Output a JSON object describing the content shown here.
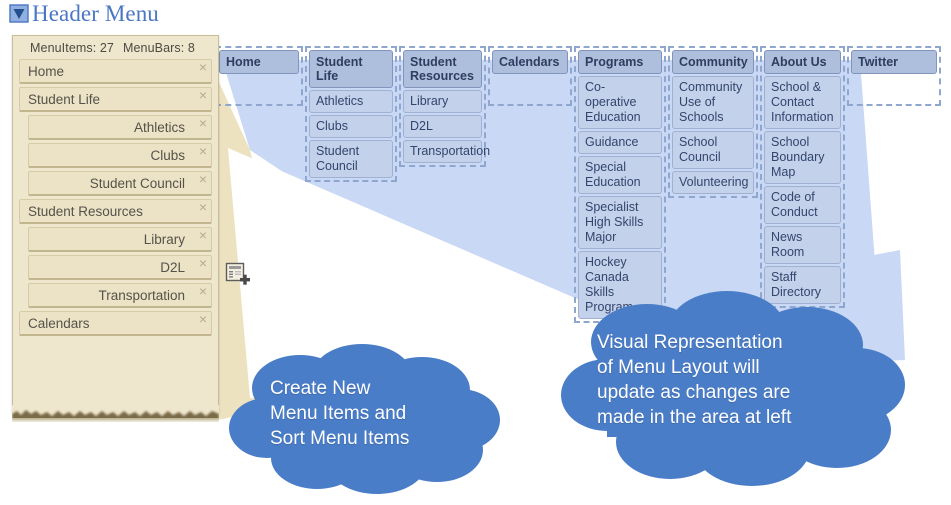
{
  "header": {
    "title": "Header Menu",
    "collapse_icon": "triangle-down-icon"
  },
  "editor_panel": {
    "counts": {
      "menu_items_label": "MenuItems: 27",
      "menu_bars_label": "MenuBars: 8"
    },
    "close_glyph": "×",
    "rows": [
      {
        "label": "Home",
        "level": 0
      },
      {
        "label": "Student Life",
        "level": 0
      },
      {
        "label": "Athletics",
        "level": 1
      },
      {
        "label": "Clubs",
        "level": 1
      },
      {
        "label": "Student Council",
        "level": 1
      },
      {
        "label": "Student Resources",
        "level": 0
      },
      {
        "label": "Library",
        "level": 1
      },
      {
        "label": "D2L",
        "level": 1
      },
      {
        "label": "Transportation",
        "level": 1
      },
      {
        "label": "Calendars",
        "level": 0
      }
    ]
  },
  "add_item_icon": "new-page-add-icon",
  "preview": {
    "columns": [
      {
        "header": "Home",
        "width": 88,
        "items": []
      },
      {
        "header": "Student Life",
        "width": 92,
        "items": [
          "Athletics",
          "Clubs",
          "Student Council"
        ]
      },
      {
        "header": "Student Resources",
        "width": 87,
        "items": [
          "Library",
          "D2L",
          "Transportation"
        ]
      },
      {
        "header": "Calendars",
        "width": 84,
        "items": []
      },
      {
        "header": "Programs",
        "width": 92,
        "items": [
          "Co-operative Education",
          "Guidance",
          "Special Education",
          "Specialist High Skills Major",
          "Hockey Canada Skills Program"
        ]
      },
      {
        "header": "Community",
        "width": 90,
        "items": [
          "Community Use of Schools",
          "School Council",
          "Volunteering"
        ]
      },
      {
        "header": "About Us",
        "width": 85,
        "items": [
          "School & Contact Information",
          "School Boundary Map",
          "Code of Conduct",
          "News Room",
          "Staff Directory"
        ]
      },
      {
        "header": "Twitter",
        "width": 94,
        "items": []
      }
    ]
  },
  "callouts": {
    "left": "Create New\nMenu Items and\nSort Menu Items",
    "right": "Visual Representation\nof Menu Layout will\nupdate as changes are\nmade in the area at left"
  },
  "colors": {
    "header_title": "#4a76c4",
    "panel_bg": "#eee6cd",
    "panel_row": "#ece2c6",
    "preview_header": "#adbfdd",
    "preview_item": "#c3d1ea",
    "cone_tan": "#ede2c0",
    "cone_blue": "#c9d8f5",
    "cloud_fill": "#4a7dc8"
  }
}
